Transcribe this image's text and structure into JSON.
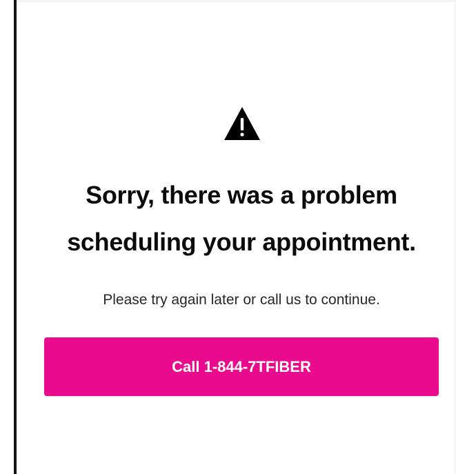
{
  "error": {
    "icon": "warning-icon",
    "title_line1": "Sorry, there was a problem",
    "title_line2": "scheduling your appointment.",
    "message": "Please try again later or call us to continue."
  },
  "actions": {
    "call_label": "Call 1-844-7TFIBER"
  },
  "colors": {
    "accent": "#ea0a8e",
    "text": "#0a0a0a",
    "background": "#ffffff",
    "frame_border": "#141414"
  }
}
